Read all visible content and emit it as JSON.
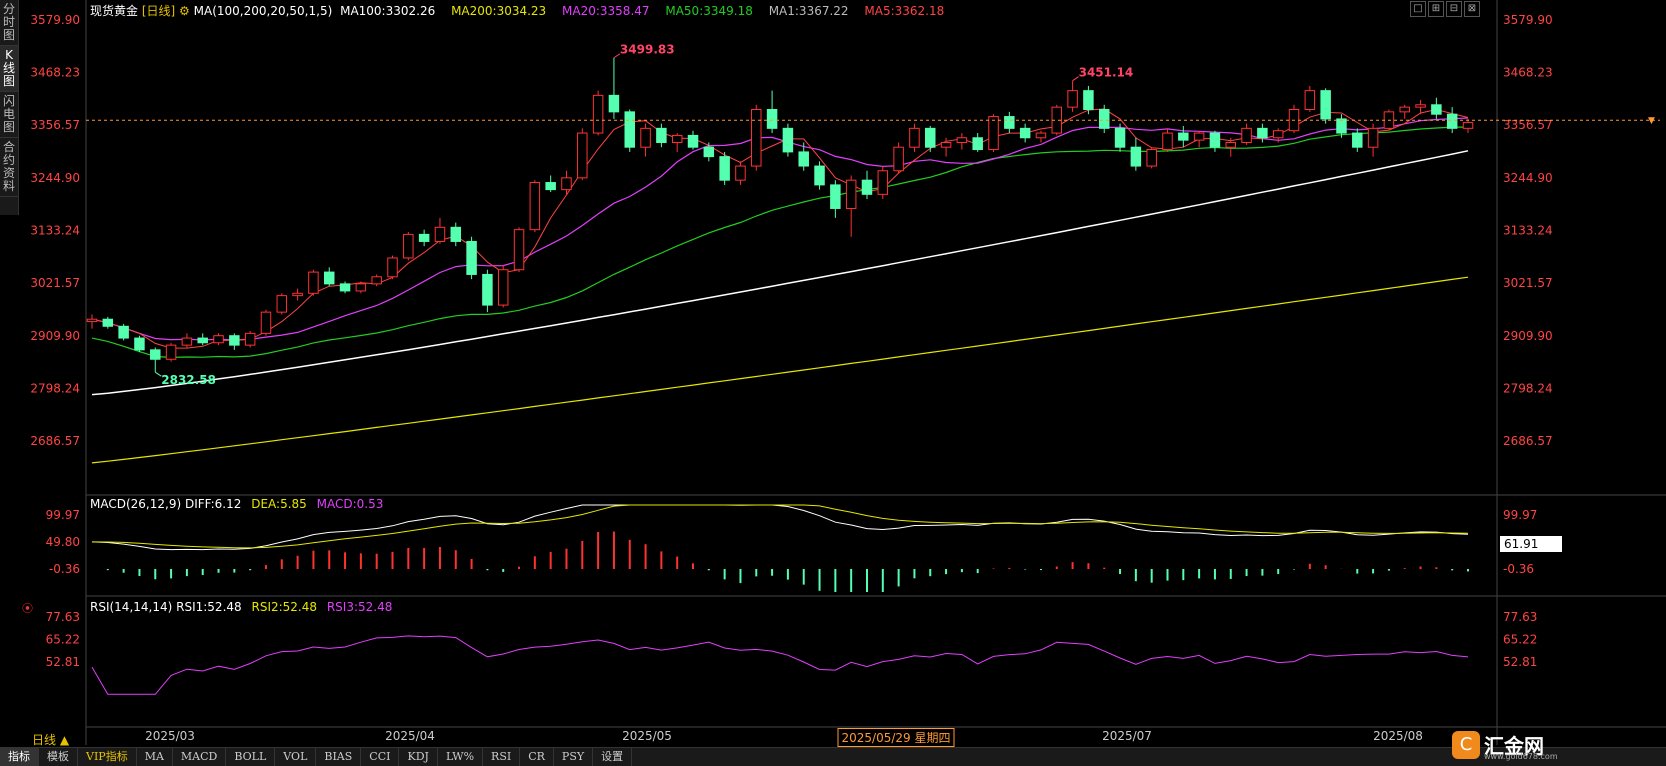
{
  "sidebar": [
    {
      "label": "分时图"
    },
    {
      "label": "K线图",
      "active": true
    },
    {
      "label": "闪电图"
    },
    {
      "label": "合约资料"
    }
  ],
  "header": {
    "symbol": "现货黄金",
    "period": "[日线]",
    "ma_params": "MA(100,200,20,50,1,5)",
    "ma100": "MA100:3302.26",
    "ma200": "MA200:3034.23",
    "ma20": "MA20:3358.47",
    "ma50": "MA50:3349.18",
    "ma1": "MA1:3367.22",
    "ma5": "MA5:3362.18"
  },
  "macd_header": {
    "params": "MACD(26,12,9)",
    "diff": "DIFF:6.12",
    "dea": "DEA:5.85",
    "macd": "MACD:0.53"
  },
  "rsi_header": {
    "params": "RSI(14,14,14)",
    "rsi1": "RSI1:52.48",
    "rsi2": "RSI2:52.48",
    "rsi3": "RSI3:52.48"
  },
  "price_axis": [
    "3579.90",
    "3468.23",
    "3356.57",
    "3244.90",
    "3133.24",
    "3021.57",
    "2909.90",
    "2798.24",
    "2686.57"
  ],
  "macd_axis": [
    "99.97",
    "49.80",
    "-0.36"
  ],
  "macd_tag": "61.91",
  "rsi_axis": [
    "77.63",
    "65.22",
    "52.81"
  ],
  "annotations": {
    "high1": "3499.83",
    "high2": "3451.14",
    "low1": "2832.58"
  },
  "dates": {
    "labels": [
      "2025/03",
      "2025/04",
      "2025/05",
      "2025/07",
      "2025/08"
    ],
    "cursor": "2025/05/29 星期四"
  },
  "period_button": "日线 ▲",
  "tabs": [
    "指标",
    "模板",
    "VIP指标",
    "MA",
    "MACD",
    "BOLL",
    "VOL",
    "BIAS",
    "CCI",
    "KDJ",
    "LW%",
    "RSI",
    "CR",
    "PSY",
    "设置"
  ],
  "logo": {
    "mark": "C",
    "text": "汇金网",
    "url": "www.gold678.com"
  },
  "window_controls": [
    "□",
    "⊞",
    "⊟",
    "⊠"
  ],
  "colors": {
    "up": "#ff3232",
    "down": "#54ffb0",
    "ma100": "#ffffff",
    "ma200": "#e6e600",
    "ma20": "#e040fb",
    "ma50": "#22cc22",
    "ma5": "#ff4444",
    "grid": "#222222",
    "axis_text": "#ff4444"
  },
  "chart_data": {
    "type": "candlestick",
    "title": "现货黄金 [日线]",
    "ylim": [
      2600,
      3600
    ],
    "last_price": 3362.18,
    "ohlc": [
      [
        2940,
        2955,
        2925,
        2945
      ],
      [
        2945,
        2950,
        2925,
        2930
      ],
      [
        2930,
        2935,
        2900,
        2905
      ],
      [
        2905,
        2910,
        2875,
        2880
      ],
      [
        2880,
        2885,
        2832.58,
        2860
      ],
      [
        2860,
        2895,
        2855,
        2890
      ],
      [
        2890,
        2915,
        2885,
        2905
      ],
      [
        2905,
        2915,
        2890,
        2895
      ],
      [
        2895,
        2915,
        2890,
        2910
      ],
      [
        2910,
        2915,
        2880,
        2890
      ],
      [
        2890,
        2920,
        2885,
        2915
      ],
      [
        2915,
        2965,
        2910,
        2960
      ],
      [
        2960,
        3000,
        2955,
        2995
      ],
      [
        2995,
        3010,
        2985,
        3000
      ],
      [
        3000,
        3050,
        2995,
        3045
      ],
      [
        3045,
        3055,
        3015,
        3020
      ],
      [
        3020,
        3025,
        3000,
        3005
      ],
      [
        3005,
        3025,
        3000,
        3020
      ],
      [
        3020,
        3040,
        3015,
        3035
      ],
      [
        3035,
        3080,
        3030,
        3075
      ],
      [
        3075,
        3130,
        3070,
        3125
      ],
      [
        3125,
        3135,
        3100,
        3110
      ],
      [
        3110,
        3160,
        3105,
        3140
      ],
      [
        3140,
        3150,
        3100,
        3110
      ],
      [
        3110,
        3120,
        3030,
        3040
      ],
      [
        3040,
        3050,
        2960,
        2975
      ],
      [
        2975,
        3060,
        2970,
        3050
      ],
      [
        3050,
        3140,
        3045,
        3135
      ],
      [
        3135,
        3240,
        3130,
        3235
      ],
      [
        3235,
        3250,
        3215,
        3220
      ],
      [
        3220,
        3260,
        3210,
        3245
      ],
      [
        3245,
        3350,
        3240,
        3340
      ],
      [
        3340,
        3430,
        3335,
        3420
      ],
      [
        3420,
        3499.83,
        3370,
        3385
      ],
      [
        3385,
        3390,
        3300,
        3310
      ],
      [
        3310,
        3360,
        3290,
        3350
      ],
      [
        3350,
        3360,
        3310,
        3320
      ],
      [
        3320,
        3340,
        3300,
        3335
      ],
      [
        3335,
        3345,
        3305,
        3310
      ],
      [
        3310,
        3320,
        3280,
        3290
      ],
      [
        3290,
        3300,
        3230,
        3240
      ],
      [
        3240,
        3280,
        3230,
        3270
      ],
      [
        3270,
        3400,
        3260,
        3390
      ],
      [
        3390,
        3430,
        3340,
        3350
      ],
      [
        3350,
        3360,
        3290,
        3300
      ],
      [
        3300,
        3320,
        3260,
        3270
      ],
      [
        3270,
        3280,
        3220,
        3230
      ],
      [
        3230,
        3240,
        3160,
        3180
      ],
      [
        3180,
        3250,
        3120,
        3240
      ],
      [
        3240,
        3260,
        3200,
        3210
      ],
      [
        3210,
        3270,
        3200,
        3260
      ],
      [
        3260,
        3320,
        3255,
        3310
      ],
      [
        3310,
        3360,
        3300,
        3350
      ],
      [
        3350,
        3355,
        3300,
        3310
      ],
      [
        3310,
        3330,
        3290,
        3320
      ],
      [
        3320,
        3340,
        3305,
        3330
      ],
      [
        3330,
        3340,
        3300,
        3305
      ],
      [
        3305,
        3380,
        3300,
        3375
      ],
      [
        3375,
        3385,
        3340,
        3350
      ],
      [
        3350,
        3360,
        3320,
        3330
      ],
      [
        3330,
        3345,
        3320,
        3340
      ],
      [
        3340,
        3400,
        3335,
        3395
      ],
      [
        3395,
        3451.14,
        3385,
        3430
      ],
      [
        3430,
        3440,
        3380,
        3390
      ],
      [
        3390,
        3400,
        3340,
        3350
      ],
      [
        3350,
        3360,
        3300,
        3310
      ],
      [
        3310,
        3330,
        3260,
        3270
      ],
      [
        3270,
        3310,
        3265,
        3305
      ],
      [
        3305,
        3350,
        3300,
        3340
      ],
      [
        3340,
        3355,
        3310,
        3325
      ],
      [
        3325,
        3345,
        3310,
        3340
      ],
      [
        3340,
        3345,
        3300,
        3310
      ],
      [
        3310,
        3330,
        3290,
        3320
      ],
      [
        3320,
        3360,
        3315,
        3350
      ],
      [
        3350,
        3360,
        3320,
        3330
      ],
      [
        3330,
        3350,
        3320,
        3345
      ],
      [
        3345,
        3400,
        3340,
        3390
      ],
      [
        3390,
        3440,
        3385,
        3430
      ],
      [
        3430,
        3435,
        3360,
        3370
      ],
      [
        3370,
        3380,
        3330,
        3340
      ],
      [
        3340,
        3350,
        3300,
        3310
      ],
      [
        3310,
        3360,
        3290,
        3350
      ],
      [
        3350,
        3390,
        3345,
        3385
      ],
      [
        3385,
        3400,
        3370,
        3395
      ],
      [
        3395,
        3410,
        3380,
        3400
      ],
      [
        3400,
        3415,
        3370,
        3380
      ],
      [
        3380,
        3395,
        3340,
        3350
      ],
      [
        3350,
        3370,
        3340,
        3362.18
      ]
    ],
    "series": [
      {
        "name": "MA100",
        "values": [
          2785,
          3302.26
        ]
      },
      {
        "name": "MA200",
        "values": [
          2640,
          3034.23
        ]
      }
    ]
  }
}
